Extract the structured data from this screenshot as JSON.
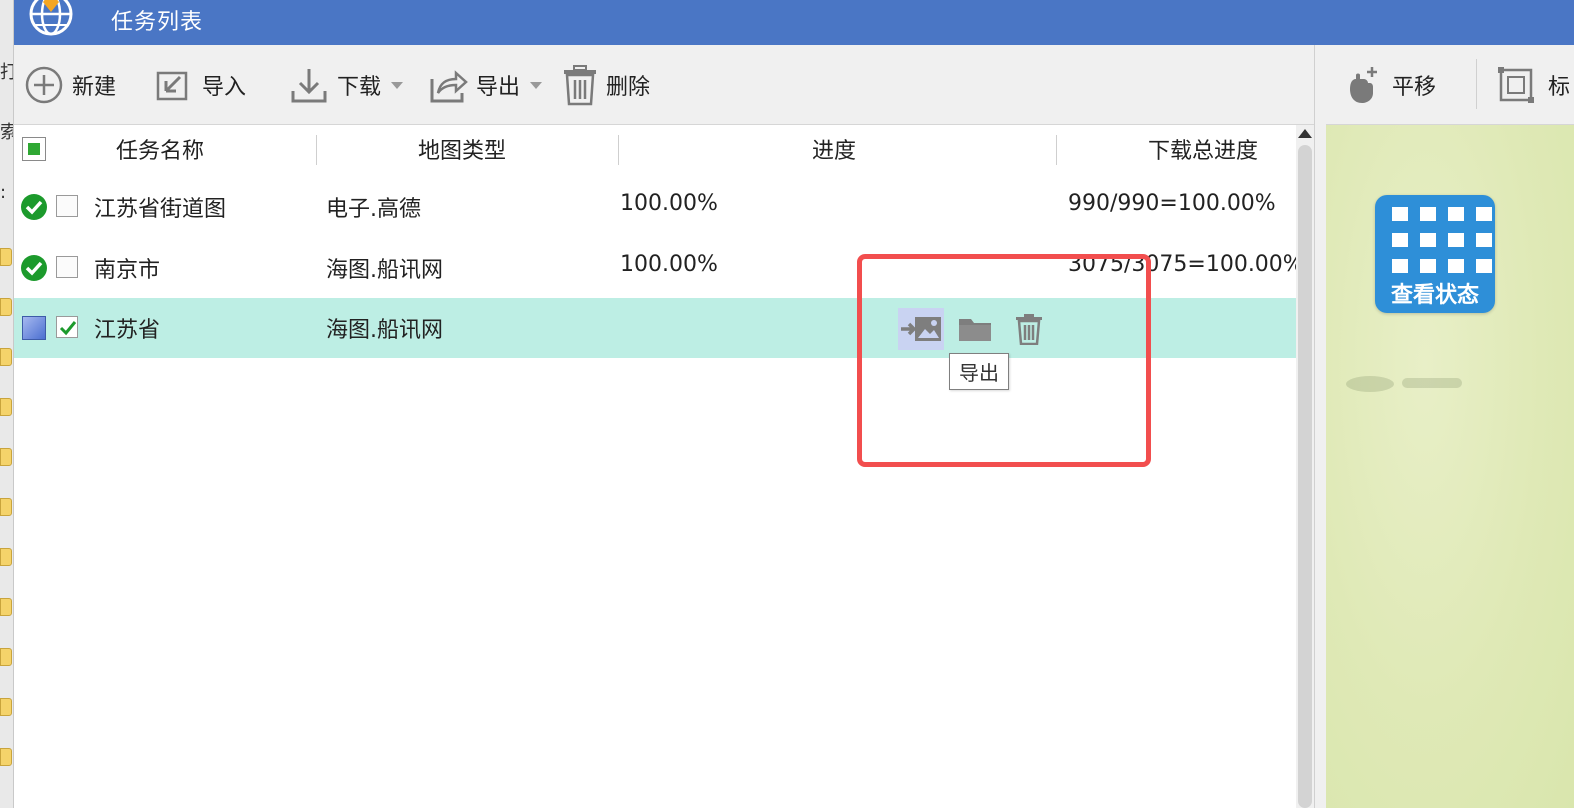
{
  "window": {
    "title": "任务列表"
  },
  "left_fragments": [
    "打",
    "索",
    ":"
  ],
  "toolbar": {
    "new_label": "新建",
    "import_label": "导入",
    "download_label": "下载",
    "export_label": "导出",
    "delete_label": "删除"
  },
  "right_toolbar": {
    "pan_label": "平移",
    "mark_label": "标"
  },
  "table": {
    "columns": [
      "任务名称",
      "地图类型",
      "进度",
      "下载总进度"
    ],
    "rows": [
      {
        "name": "江苏省街道图",
        "map_type": "电子.高德",
        "progress": "100.00%",
        "total": "990/990=100.00%",
        "checked": false,
        "status": "done"
      },
      {
        "name": "南京市",
        "map_type": "海图.船讯网",
        "progress": "100.00%",
        "total": "3075/3075=100.00%",
        "checked": false,
        "status": "done"
      },
      {
        "name": "江苏省",
        "map_type": "海图.船讯网",
        "progress": "",
        "total": "",
        "checked": true,
        "status": "pending"
      }
    ]
  },
  "row_actions": {
    "tooltip": "导出"
  },
  "map_panel": {
    "status_button_label": "查看状态"
  },
  "colors": {
    "titlebar": "#4a76c5",
    "selected_row": "#bdeee4",
    "highlight": "#f24e4e",
    "status_tile": "#2e8fd8",
    "map_bg": "#dfe9b6"
  }
}
